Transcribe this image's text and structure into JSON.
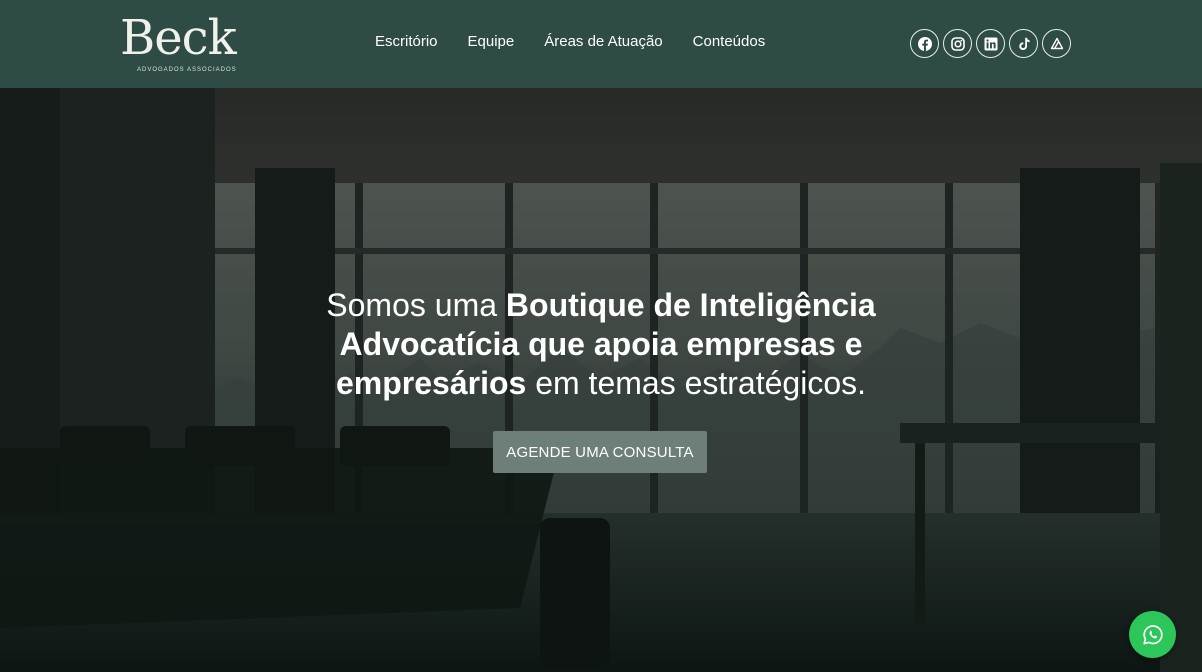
{
  "brand": {
    "name": "Beck",
    "tagline": "ADVOGADOS ASSOCIADOS"
  },
  "nav": {
    "items": [
      {
        "label": "Escritório"
      },
      {
        "label": "Equipe"
      },
      {
        "label": "Áreas de Atuação"
      },
      {
        "label": "Conteúdos"
      }
    ]
  },
  "social": {
    "icons": [
      "facebook-icon",
      "instagram-icon",
      "linkedin-icon",
      "tiktok-icon",
      "jusbrasil-icon"
    ]
  },
  "hero": {
    "headline_part1": "Somos uma ",
    "headline_bold1": "Boutique de Inteligência Advocatícia que apoia empresas e empresários",
    "headline_part2": " em temas estratégicos.",
    "cta_label": "AGENDE UMA CONSULTA"
  },
  "colors": {
    "header_bg": "#2e4b45",
    "cta_bg": "#6e7e78",
    "whatsapp": "#2dc65a"
  },
  "floating": {
    "whatsapp_icon": "whatsapp-icon"
  }
}
